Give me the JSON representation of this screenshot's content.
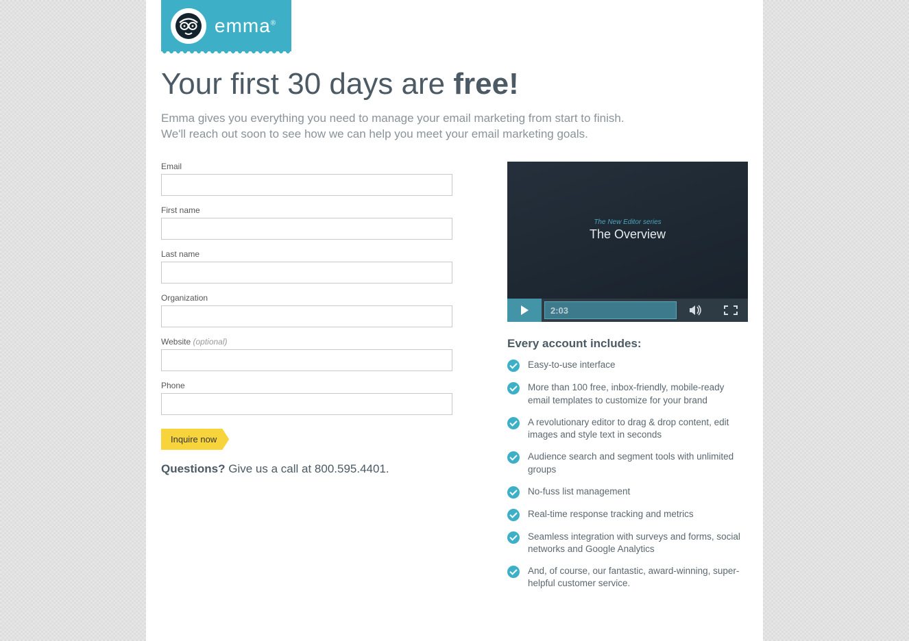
{
  "brand": {
    "name": "emma",
    "trademark": "®"
  },
  "headline": {
    "prefix": "Your first 30 days are ",
    "emphasis": "free!"
  },
  "subhead_line1": "Emma gives you everything you need to manage your email marketing from start to finish.",
  "subhead_line2": "We'll reach out soon to see how we can help you meet your email marketing goals.",
  "form": {
    "email_label": "Email",
    "first_name_label": "First name",
    "last_name_label": "Last name",
    "organization_label": "Organization",
    "website_label": "Website",
    "website_optional": "(optional)",
    "phone_label": "Phone",
    "submit_label": "Inquire now"
  },
  "questions": {
    "strong": "Questions?",
    "rest": " Give us a call at 800.595.4401."
  },
  "video": {
    "series": "The New Editor series",
    "title": "The Overview",
    "duration": "2:03"
  },
  "includes_heading": "Every account includes:",
  "features": [
    "Easy-to-use interface",
    "More than 100 free, inbox-friendly, mobile-ready email templates to customize for your brand",
    "A revolutionary editor to drag & drop content, edit images and style text in seconds",
    "Audience search and segment tools with unlimited groups",
    "No-fuss list management",
    "Real-time response tracking and metrics",
    "Seamless integration with surveys and forms, social networks and Google Analytics",
    "And, of course, our fantastic, award-winning, super-helpful customer service."
  ]
}
